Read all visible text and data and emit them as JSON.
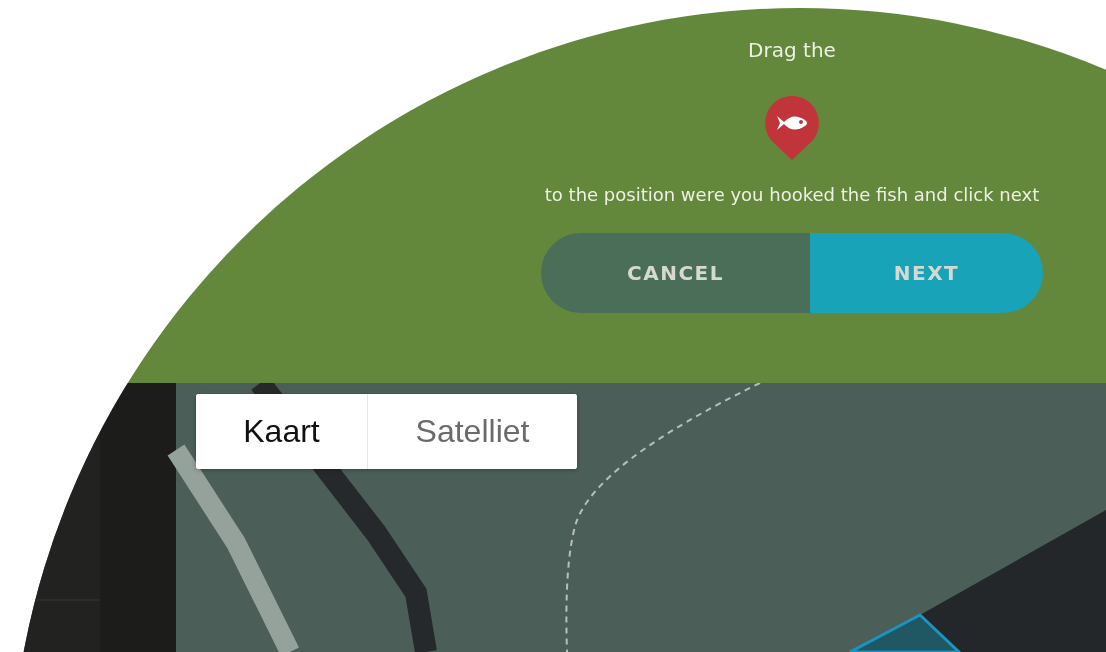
{
  "prompt": {
    "line_1": "Drag the",
    "line_2": "to the position were you hooked the fish and click next",
    "buttons": [
      {
        "label": "CANCEL",
        "kind": "secondary"
      },
      {
        "label": "NEXT",
        "kind": "primary"
      }
    ]
  },
  "map": {
    "map_types": [
      {
        "label": "Kaart",
        "selected": true
      },
      {
        "label": "Satelliet",
        "selected": false
      }
    ]
  }
}
